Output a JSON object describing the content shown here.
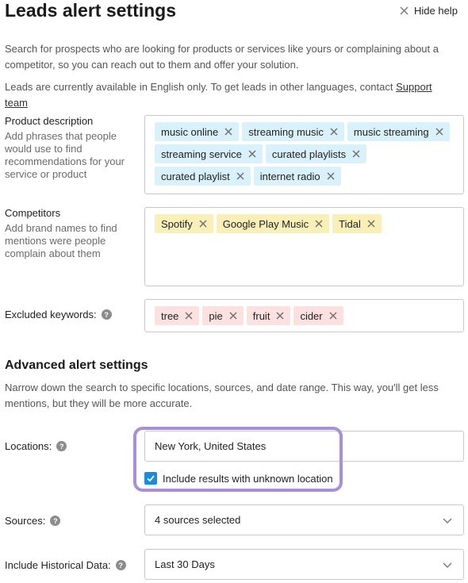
{
  "header": {
    "title": "Leads alert settings",
    "hide_help_label": "Hide help",
    "hide_help_icon": "close-icon"
  },
  "intro": {
    "text_1": "Search for prospects who are looking for products or services like yours or complaining about a competitor, so you can reach out to them and offer your solution.",
    "text_2_prefix": "Leads are currently available in English only. To get leads in other languages, contact ",
    "support_link": "Support team"
  },
  "product_description": {
    "label": "Product description",
    "help": "Add phrases that people would use to find recommendations for your service or product",
    "tags": [
      "music online",
      "streaming music",
      "music streaming",
      "streaming service",
      "curated playlists",
      "curated playlist",
      "internet radio"
    ]
  },
  "competitors": {
    "label": "Competitors",
    "help": "Add brand names to find mentions were people complain about them",
    "tags": [
      "Spotify",
      "Google Play Music",
      "Tidal"
    ]
  },
  "excluded": {
    "label": "Excluded keywords:",
    "tags": [
      "tree",
      "pie",
      "fruit",
      "cider"
    ]
  },
  "advanced": {
    "title": "Advanced alert settings",
    "description": "Narrow down the search to specific locations, sources, and date range. This way, you'll get less mentions, but they will be more accurate."
  },
  "locations": {
    "label": "Locations:",
    "value": "New York, United States",
    "checkbox_label": "Include results with unknown location",
    "checkbox_checked": true
  },
  "sources": {
    "label": "Sources:",
    "value": "4 sources selected"
  },
  "historical": {
    "label": "Include Historical Data:",
    "value": "Last 30 Days"
  },
  "colors": {
    "tag_blue": "#d9f1fb",
    "tag_yellow": "#fbefb8",
    "tag_red": "#fde0e0",
    "highlight": "#a98fd6",
    "checkbox": "#1a8cdc"
  }
}
